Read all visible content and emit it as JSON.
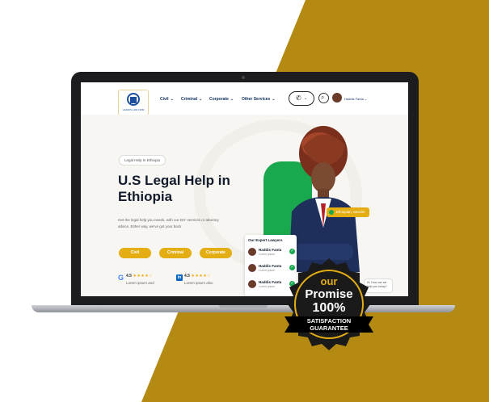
{
  "colors": {
    "gold": "#b58a12",
    "accent": "#e4ad12",
    "green": "#1aa84f",
    "navy": "#0f2e5a"
  },
  "header": {
    "logo_text": "HADDIS LAW FIRM",
    "nav": [
      {
        "label": "Civil"
      },
      {
        "label": "Criminal"
      },
      {
        "label": "Corporate"
      },
      {
        "label": "Other Services"
      }
    ],
    "call_icon": "phone-icon",
    "user_name": "Haddis Fanta"
  },
  "hero": {
    "pill": "Legal Help In Ethiopia",
    "title_line1": "U.S Legal Help in",
    "title_line2": "Ethiopia",
    "description": "Get the legal help you needs, with our DIY services or attorney advice. Either way, we've got your back",
    "buttons": [
      "Civil",
      "Criminal",
      "Corporate"
    ],
    "ratings": [
      {
        "source": "google",
        "score": "4.5",
        "stars": "★★★★☆",
        "sub": "Lorem ipsum and"
      },
      {
        "source": "linkedin",
        "score": "4.5",
        "stars": "★★★★☆",
        "sub": "Lorem ipsum also"
      }
    ],
    "location_tag": "Ethiopian, Muslim"
  },
  "experts": {
    "title": "Our Expert Lawyers",
    "items": [
      {
        "name": "Haddis Fanta",
        "sub": "Lorem ipsum"
      },
      {
        "name": "Haddis Fanta",
        "sub": "Lorem ipsum"
      },
      {
        "name": "Haddis Fanta",
        "sub": "Lorem ipsum"
      }
    ]
  },
  "chat": {
    "text": "Hi, How can we help you today?"
  },
  "badge": {
    "line1": "our",
    "line2": "Promise",
    "line3": "100%",
    "line4": "SATISFACTION",
    "line5": "GUARANTEE"
  }
}
